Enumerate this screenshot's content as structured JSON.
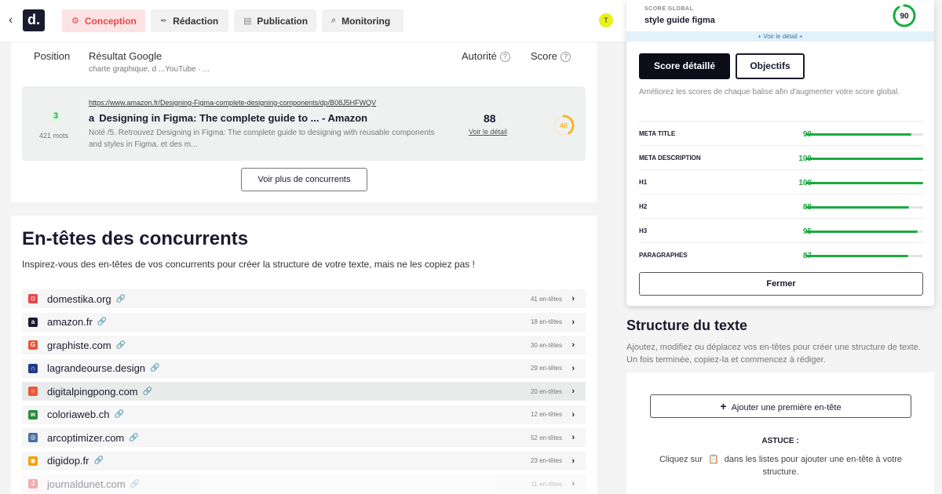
{
  "topbar": {
    "back": "‹",
    "logo": "d.",
    "tabs": [
      {
        "label": "Conception",
        "icon": "⚙"
      },
      {
        "label": "Rédaction",
        "icon": "✒"
      },
      {
        "label": "Publication",
        "icon": "▤"
      },
      {
        "label": "Monitoring",
        "icon": "⌕"
      }
    ],
    "avatar": "T"
  },
  "results": {
    "headers": {
      "position": "Position",
      "google": "Résultat Google",
      "autorite": "Autorité",
      "score": "Score",
      "help": "?"
    },
    "truncated_line": "charte graphique, d ...YouTube · ...",
    "row": {
      "position": "3",
      "words": "421 mots",
      "url": "https://www.amazon.fr/Designing-Figma-complete-designing-components/dp/B08J5HFWQV",
      "title": "Designing in Figma: The complete guide to ... - Amazon",
      "favicon": "a",
      "description": "Noté /5. Retrouvez Designing in Figma: The complete guide to designing with reusable components and styles in Figma. et des m...",
      "authority": "88",
      "detail_link": "Voir le détail",
      "score": "40",
      "score_fraction": 0.4,
      "score_color": "#f2b72c"
    },
    "more_button": "Voir plus de concurrents"
  },
  "competitors": {
    "title": "En-têtes des concurrents",
    "subtitle": "Inspirez-vous des en-têtes de vos concurrents pour créer la structure de votre texte, mais ne les copiez pas !",
    "link_icon": "🔗",
    "chevron": "›",
    "items": [
      {
        "domain": "domestika.org",
        "count": "41 en-têtes",
        "color": "#e5484d",
        "glyph": "◘"
      },
      {
        "domain": "amazon.fr",
        "count": "18 en-têtes",
        "color": "#1b1b2f",
        "glyph": "a"
      },
      {
        "domain": "graphiste.com",
        "count": "30 en-têtes",
        "color": "#e85535",
        "glyph": "G"
      },
      {
        "domain": "lagrandeourse.design",
        "count": "29 en-têtes",
        "color": "#1f3c88",
        "glyph": "∩"
      },
      {
        "domain": "digitalpingpong.com",
        "count": "20 en-têtes",
        "color": "#e8593a",
        "glyph": "○"
      },
      {
        "domain": "coloriaweb.ch",
        "count": "12 en-têtes",
        "color": "#2b8a3e",
        "glyph": "w"
      },
      {
        "domain": "arcoptimizer.com",
        "count": "52 en-têtes",
        "color": "#4a6fa5",
        "glyph": "◎"
      },
      {
        "domain": "digidop.fr",
        "count": "23 en-têtes",
        "color": "#f2a20c",
        "glyph": "◉"
      },
      {
        "domain": "journaldunet.com",
        "count": "11 en-têtes",
        "color": "#e5484d",
        "glyph": "J"
      }
    ]
  },
  "score_panel": {
    "label": "SCORE GLOBAL",
    "keyword": "style guide figma",
    "score": "90",
    "score_fraction": 0.9,
    "detail_toggle": "+ Voir le détail +",
    "tab_detail": "Score détaillé",
    "tab_objectives": "Objectifs",
    "description": "Améliorez les scores de chaque balise afin d'augmenter votre score global.",
    "metrics": [
      {
        "label": "META TITLE",
        "value": "90",
        "fraction": 0.9
      },
      {
        "label": "META DESCRIPTION",
        "value": "100",
        "fraction": 1.0
      },
      {
        "label": "H1",
        "value": "100",
        "fraction": 1.0
      },
      {
        "label": "H2",
        "value": "88",
        "fraction": 0.88
      },
      {
        "label": "H3",
        "value": "95",
        "fraction": 0.95
      },
      {
        "label": "PARAGRAPHES",
        "value": "87",
        "fraction": 0.87
      }
    ],
    "close_button": "Fermer"
  },
  "structure": {
    "title": "Structure du texte",
    "description": "Ajoutez, modifiez ou déplacez vos en-têtes pour créer une structure de texte. Un fois terminée, copiez-la et commencez à rédiger.",
    "add_button": "Ajouter une première en-tête",
    "add_icon": "+",
    "tip_title": "ASTUCE :",
    "tip_before": "Cliquez sur",
    "tip_icon": "📋",
    "tip_after": "dans les listes pour ajouter une en-tête à votre structure."
  },
  "colors": {
    "accent_green": "#1aab3f",
    "accent_red": "#e5484d",
    "accent_orange": "#f2b72c"
  }
}
